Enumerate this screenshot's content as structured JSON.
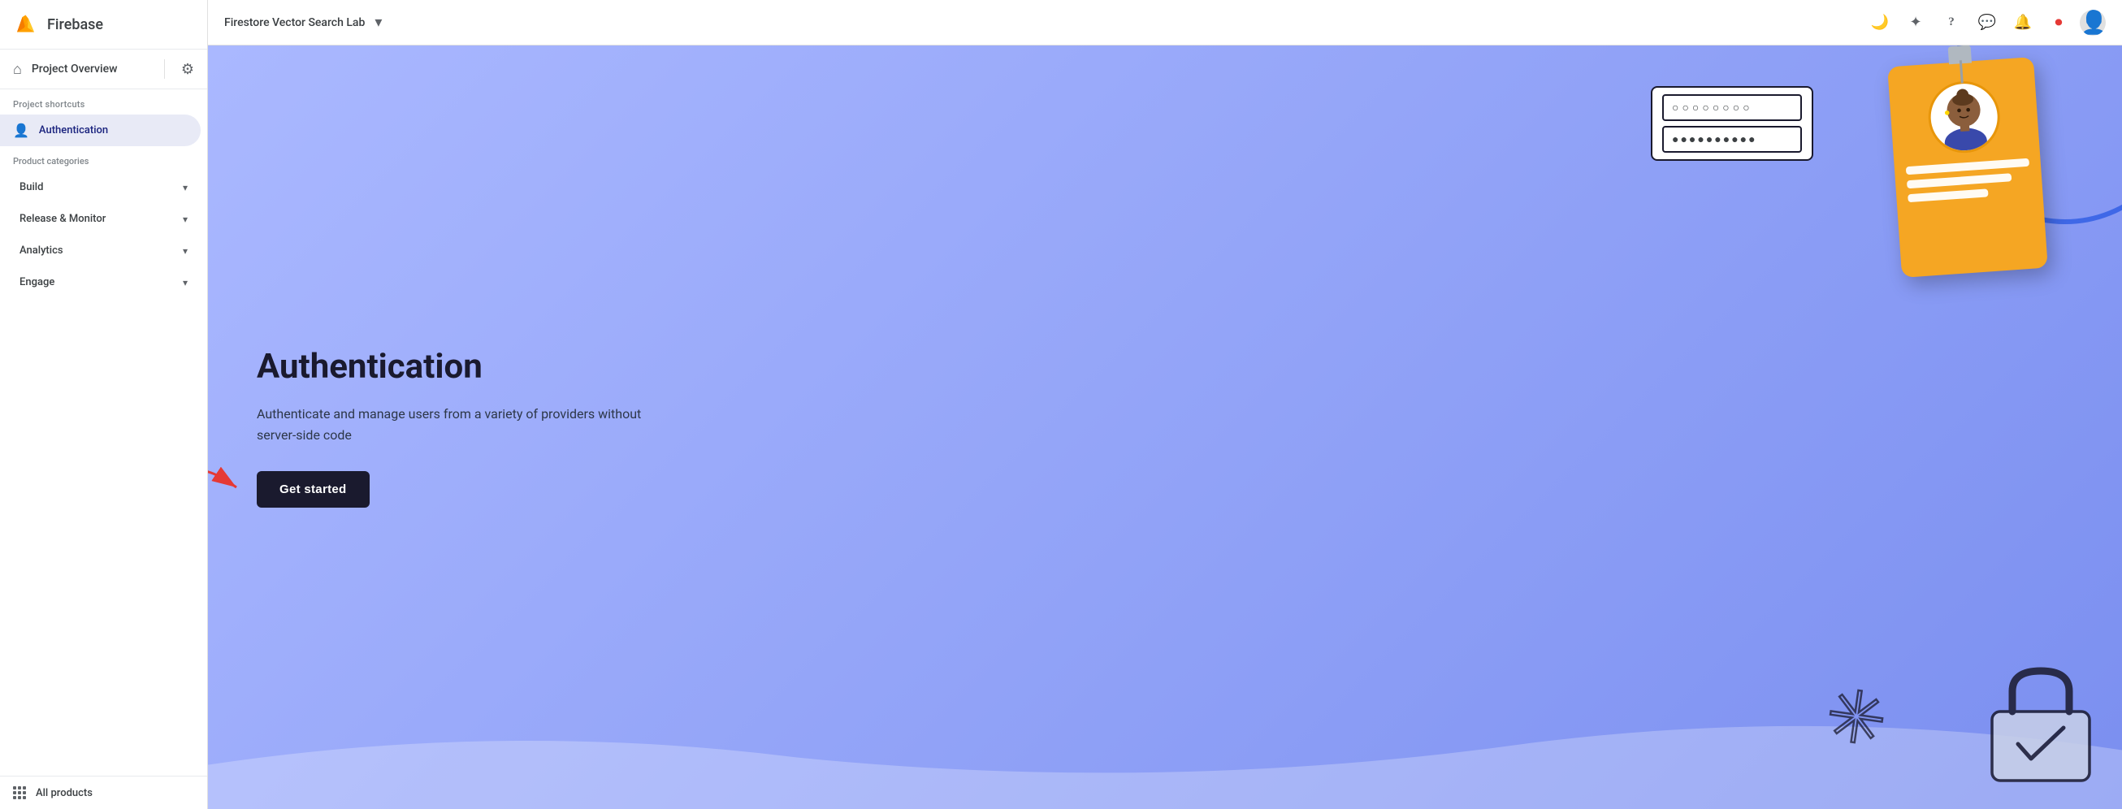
{
  "sidebar": {
    "logo_text": "Firebase",
    "project_overview": "Project Overview",
    "settings_label": "Settings",
    "project_shortcuts_label": "Project shortcuts",
    "authentication_item": "Authentication",
    "product_categories_label": "Product categories",
    "build_item": "Build",
    "release_monitor_item": "Release & Monitor",
    "analytics_item": "Analytics",
    "engage_item": "Engage",
    "all_products_item": "All products"
  },
  "topbar": {
    "project_name": "Firestore Vector Search Lab",
    "dropdown_symbol": "▼",
    "moon_icon": "🌙",
    "spark_icon": "✦",
    "help_icon": "?",
    "chat_icon": "💬",
    "notifications_icon": "🔔",
    "record_icon": "⏺"
  },
  "hero": {
    "title": "Authentication",
    "description": "Authenticate and manage users from a variety of providers without server-side code",
    "get_started_label": "Get started"
  },
  "illustration": {
    "password_field_1": "○○○○○○○○",
    "password_field_2": "●●●●●●●●●●"
  }
}
